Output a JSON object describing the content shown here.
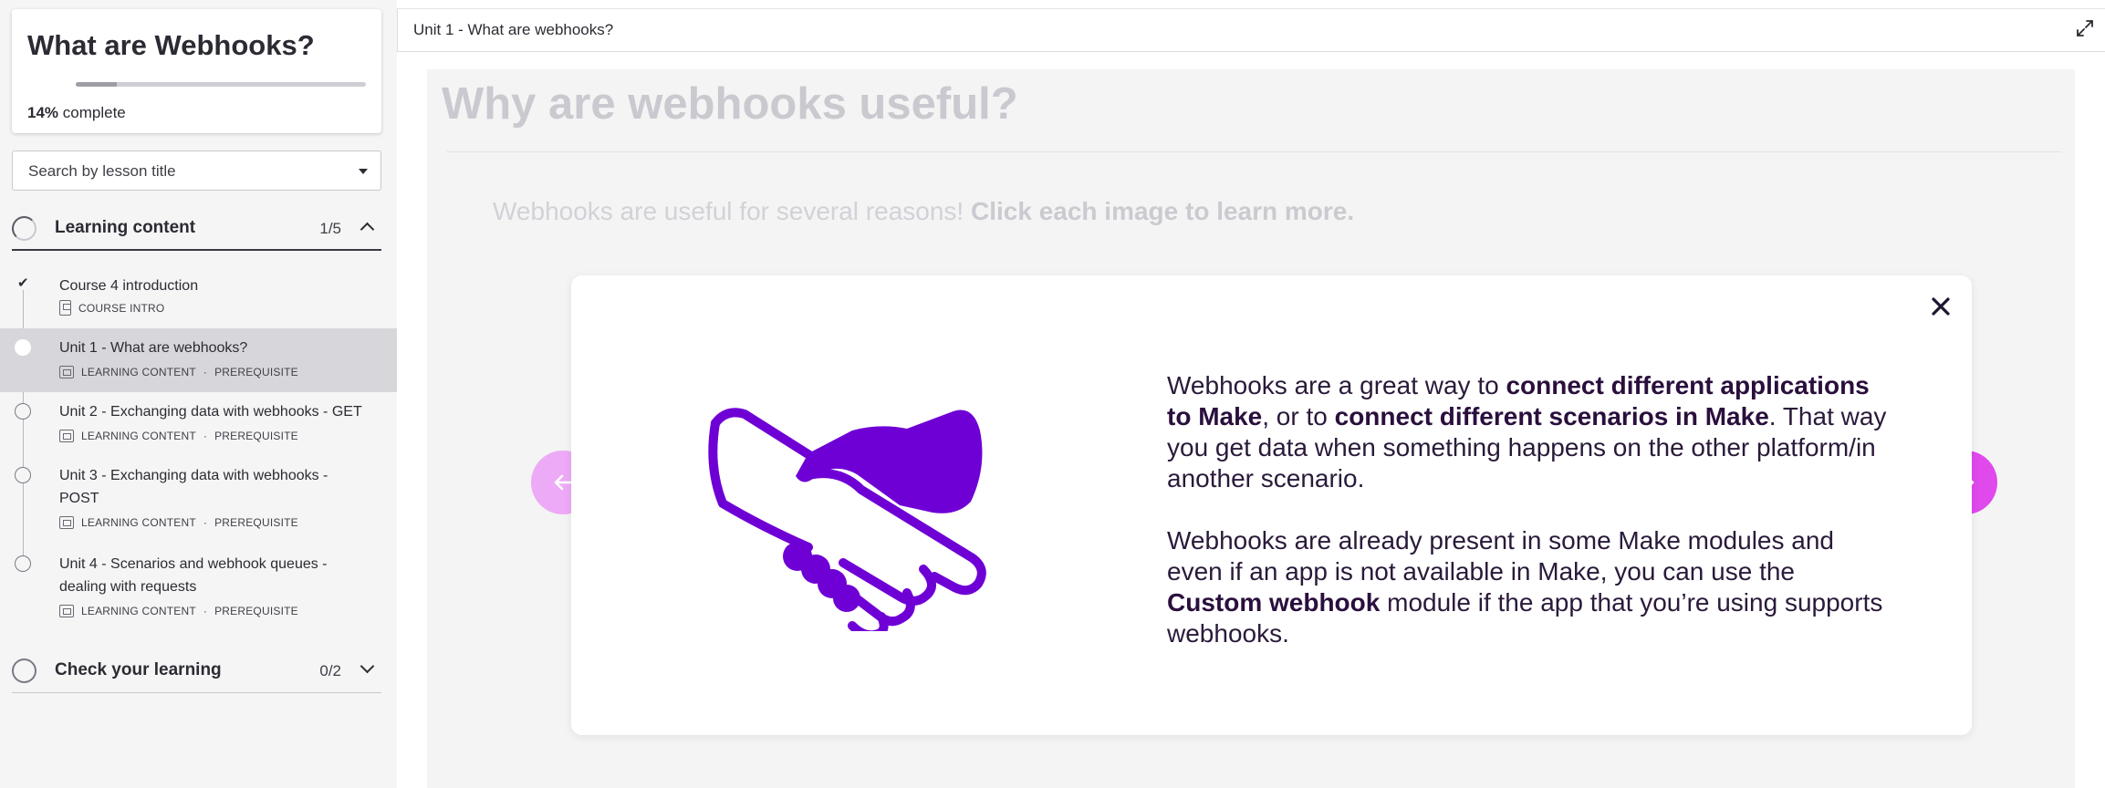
{
  "course": {
    "title": "What are Webhooks?",
    "progress_percent": 14,
    "progress_value": "14%",
    "progress_suffix": "complete"
  },
  "search": {
    "placeholder": "Search by lesson title"
  },
  "sections": [
    {
      "title": "Learning content",
      "count": "1/5",
      "expanded": true,
      "lessons": [
        {
          "title": "Course 4 introduction",
          "meta": "COURSE INTRO",
          "status": "complete"
        },
        {
          "title": "Unit 1 - What are webhooks?",
          "meta_type": "LEARNING CONTENT",
          "meta_sep": "·",
          "meta_req": "PREREQUISITE",
          "status": "active"
        },
        {
          "title": "Unit 2 - Exchanging data with webhooks - GET",
          "meta_type": "LEARNING CONTENT",
          "meta_sep": "·",
          "meta_req": "PREREQUISITE",
          "status": "todo"
        },
        {
          "title": "Unit 3 - Exchanging data with webhooks - POST",
          "meta_type": "LEARNING CONTENT",
          "meta_sep": "·",
          "meta_req": "PREREQUISITE",
          "status": "todo"
        },
        {
          "title": "Unit 4 - Scenarios and webhook queues - dealing with requests",
          "meta_type": "LEARNING CONTENT",
          "meta_sep": "·",
          "meta_req": "PREREQUISITE",
          "status": "todo"
        }
      ]
    },
    {
      "title": "Check your learning",
      "count": "0/2",
      "expanded": false
    }
  ],
  "header": {
    "breadcrumb": "Unit 1 - What are webhooks?",
    "expand_icon": "expand-icon"
  },
  "page": {
    "heading": "Why are webhooks useful?",
    "intro_plain": "Webhooks are useful for several reasons! ",
    "intro_bold": "Click each image to learn more."
  },
  "modal": {
    "image": "handshake-icon",
    "p1": [
      {
        "t": "Webhooks are a great way to ",
        "b": false
      },
      {
        "t": "connect different applications to Make",
        "b": true
      },
      {
        "t": ", or to ",
        "b": false
      },
      {
        "t": "connect different scenarios in Make",
        "b": true
      },
      {
        "t": ". That way you get data when something happens on the other platform/in another scenario.",
        "b": false
      }
    ],
    "p2": [
      {
        "t": "Webhooks are already present in some Make modules and even if an app is not available in Make, you can use the ",
        "b": false
      },
      {
        "t": "Custom webhook",
        "b": true
      },
      {
        "t": " module if the app that you’re using supports webhooks.",
        "b": false
      }
    ]
  },
  "colors": {
    "accent": "#e049ec",
    "accent_disabled": "#edaaf6",
    "illustration": "#6f00d5",
    "active_row": "#d7d7db"
  }
}
